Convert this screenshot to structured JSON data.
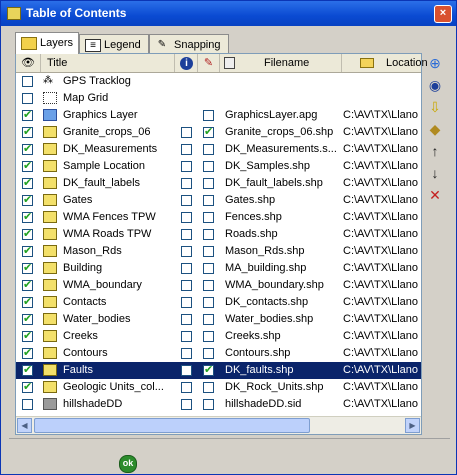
{
  "window": {
    "title": "Table of Contents",
    "close_label": "×"
  },
  "tabs": [
    {
      "label": "Layers",
      "icon": "layers-icon",
      "active": true
    },
    {
      "label": "Legend",
      "icon": "legend-icon",
      "active": false
    },
    {
      "label": "Snapping",
      "icon": "snapping-icon",
      "active": false
    }
  ],
  "columns": {
    "title": "Title",
    "filename": "Filename",
    "location": "Location",
    "info_icon": "info-icon",
    "edit_icon": "pencil-icon",
    "visibility_icon": "eye-icon",
    "file_icon": "file-icon",
    "folder_icon": "folder-icon"
  },
  "layers": [
    {
      "title": "GPS Tracklog",
      "filename": "",
      "location": "",
      "visible": false,
      "col_a": null,
      "col_b": null,
      "icon": "gps-icon"
    },
    {
      "title": "Map Grid",
      "filename": "",
      "location": "",
      "visible": false,
      "col_a": null,
      "col_b": null,
      "icon": "grid-icon"
    },
    {
      "title": "Graphics Layer",
      "filename": "GraphicsLayer.apg",
      "location": "C:\\AV\\TX\\Llano",
      "visible": true,
      "col_a": null,
      "col_b": false,
      "icon": "graphics-icon"
    },
    {
      "title": "Granite_crops_06",
      "filename": "Granite_crops_06.shp",
      "location": "C:\\AV\\TX\\Llano",
      "visible": true,
      "col_a": false,
      "col_b": true,
      "icon": "polygon-icon"
    },
    {
      "title": "DK_Measurements",
      "filename": "DK_Measurements.s...",
      "location": "C:\\AV\\TX\\Llano",
      "visible": true,
      "col_a": false,
      "col_b": false,
      "icon": "point-icon"
    },
    {
      "title": "Sample Location",
      "filename": "DK_Samples.shp",
      "location": "C:\\AV\\TX\\Llano",
      "visible": true,
      "col_a": false,
      "col_b": false,
      "icon": "point-icon"
    },
    {
      "title": "DK_fault_labels",
      "filename": "DK_fault_labels.shp",
      "location": "C:\\AV\\TX\\Llano",
      "visible": true,
      "col_a": false,
      "col_b": false,
      "icon": "point-icon"
    },
    {
      "title": "Gates",
      "filename": "Gates.shp",
      "location": "C:\\AV\\TX\\Llano",
      "visible": true,
      "col_a": false,
      "col_b": false,
      "icon": "point-icon"
    },
    {
      "title": "WMA Fences TPW",
      "filename": "Fences.shp",
      "location": "C:\\AV\\TX\\Llano",
      "visible": true,
      "col_a": false,
      "col_b": false,
      "icon": "line-icon"
    },
    {
      "title": "WMA Roads TPW",
      "filename": "Roads.shp",
      "location": "C:\\AV\\TX\\Llano",
      "visible": true,
      "col_a": false,
      "col_b": false,
      "icon": "line-icon"
    },
    {
      "title": "Mason_Rds",
      "filename": "Mason_Rds.shp",
      "location": "C:\\AV\\TX\\Llano",
      "visible": true,
      "col_a": false,
      "col_b": false,
      "icon": "line-icon"
    },
    {
      "title": "Building",
      "filename": "MA_building.shp",
      "location": "C:\\AV\\TX\\Llano",
      "visible": true,
      "col_a": false,
      "col_b": false,
      "icon": "polygon-icon"
    },
    {
      "title": "WMA_boundary",
      "filename": "WMA_boundary.shp",
      "location": "C:\\AV\\TX\\Llano",
      "visible": true,
      "col_a": false,
      "col_b": false,
      "icon": "polygon-icon"
    },
    {
      "title": "Contacts",
      "filename": "DK_contacts.shp",
      "location": "C:\\AV\\TX\\Llano",
      "visible": true,
      "col_a": false,
      "col_b": false,
      "icon": "line-icon"
    },
    {
      "title": "Water_bodies",
      "filename": "Water_bodies.shp",
      "location": "C:\\AV\\TX\\Llano",
      "visible": true,
      "col_a": false,
      "col_b": false,
      "icon": "polygon-icon"
    },
    {
      "title": "Creeks",
      "filename": "Creeks.shp",
      "location": "C:\\AV\\TX\\Llano",
      "visible": true,
      "col_a": false,
      "col_b": false,
      "icon": "line-icon"
    },
    {
      "title": "Contours",
      "filename": "Contours.shp",
      "location": "C:\\AV\\TX\\Llano",
      "visible": true,
      "col_a": false,
      "col_b": false,
      "icon": "line-icon"
    },
    {
      "title": "Faults",
      "filename": "DK_faults.shp",
      "location": "C:\\AV\\TX\\Llano",
      "visible": true,
      "col_a": false,
      "col_b": true,
      "icon": "line-icon",
      "selected": true
    },
    {
      "title": "Geologic Units_col...",
      "filename": "DK_Rock_Units.shp",
      "location": "C:\\AV\\TX\\Llano",
      "visible": true,
      "col_a": false,
      "col_b": false,
      "icon": "polygon-icon"
    },
    {
      "title": "hillshadeDD",
      "filename": "hillshadeDD.sid",
      "location": "C:\\AV\\TX\\Llano",
      "visible": false,
      "col_a": false,
      "col_b": false,
      "icon": "raster-icon"
    }
  ],
  "side_toolbar": [
    {
      "name": "add-layer-button",
      "glyph": "⊕"
    },
    {
      "name": "layer-properties-button",
      "glyph": "◉"
    },
    {
      "name": "download-button",
      "glyph": "⇩"
    },
    {
      "name": "label-button",
      "glyph": "◆"
    },
    {
      "name": "move-up-button",
      "glyph": "↑"
    },
    {
      "name": "move-down-button",
      "glyph": "↓"
    },
    {
      "name": "remove-layer-button",
      "glyph": "✕"
    }
  ],
  "ok_button": {
    "label": "ok"
  }
}
